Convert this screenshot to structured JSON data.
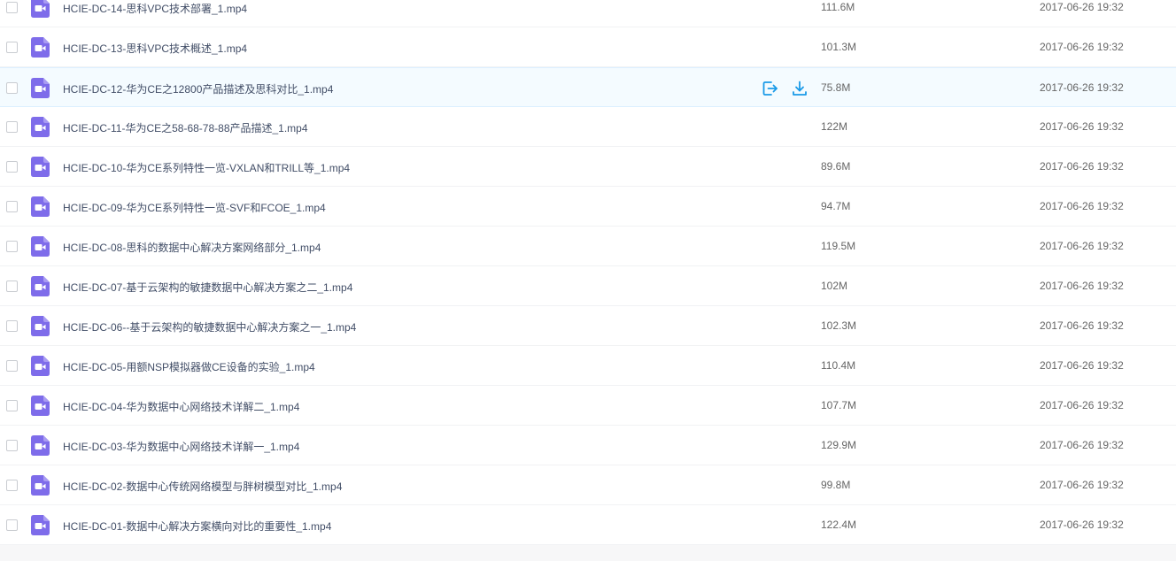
{
  "colors": {
    "icon_bg": "#7e6cea",
    "action_blue": "#1a9ae8",
    "hover_row_bg": "#f4fbff"
  },
  "icons": {
    "file": "video-file-icon",
    "share": "share-icon",
    "download": "download-icon"
  },
  "files": [
    {
      "name": "HCIE-DC-14-思科VPC技术部署_1.mp4",
      "size": "111.6M",
      "date": "2017-06-26 19:32"
    },
    {
      "name": "HCIE-DC-13-思科VPC技术概述_1.mp4",
      "size": "101.3M",
      "date": "2017-06-26 19:32"
    },
    {
      "name": "HCIE-DC-12-华为CE之12800产品描述及思科对比_1.mp4",
      "size": "75.8M",
      "date": "2017-06-26 19:32",
      "hovered": true
    },
    {
      "name": "HCIE-DC-11-华为CE之58-68-78-88产品描述_1.mp4",
      "size": "122M",
      "date": "2017-06-26 19:32"
    },
    {
      "name": "HCIE-DC-10-华为CE系列特性一览-VXLAN和TRILL等_1.mp4",
      "size": "89.6M",
      "date": "2017-06-26 19:32"
    },
    {
      "name": "HCIE-DC-09-华为CE系列特性一览-SVF和FCOE_1.mp4",
      "size": "94.7M",
      "date": "2017-06-26 19:32"
    },
    {
      "name": "HCIE-DC-08-思科的数据中心解决方案网络部分_1.mp4",
      "size": "119.5M",
      "date": "2017-06-26 19:32"
    },
    {
      "name": "HCIE-DC-07-基于云架构的敏捷数据中心解决方案之二_1.mp4",
      "size": "102M",
      "date": "2017-06-26 19:32"
    },
    {
      "name": "HCIE-DC-06--基于云架构的敏捷数据中心解决方案之一_1.mp4",
      "size": "102.3M",
      "date": "2017-06-26 19:32"
    },
    {
      "name": "HCIE-DC-05-用额NSP模拟器做CE设备的实验_1.mp4",
      "size": "110.4M",
      "date": "2017-06-26 19:32"
    },
    {
      "name": "HCIE-DC-04-华为数据中心网络技术详解二_1.mp4",
      "size": "107.7M",
      "date": "2017-06-26 19:32"
    },
    {
      "name": "HCIE-DC-03-华为数据中心网络技术详解一_1.mp4",
      "size": "129.9M",
      "date": "2017-06-26 19:32"
    },
    {
      "name": "HCIE-DC-02-数据中心传统网络模型与胖树模型对比_1.mp4",
      "size": "99.8M",
      "date": "2017-06-26 19:32"
    },
    {
      "name": "HCIE-DC-01-数据中心解决方案横向对比的重要性_1.mp4",
      "size": "122.4M",
      "date": "2017-06-26 19:32"
    }
  ]
}
